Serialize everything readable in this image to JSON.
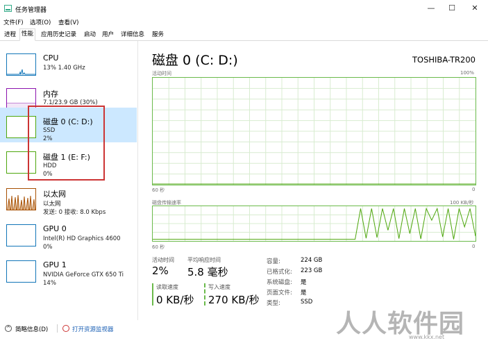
{
  "window": {
    "title": "任务管理器",
    "minimize": "—",
    "maximize": "☐",
    "close": "✕"
  },
  "menu": [
    "文件(F)",
    "选项(O)",
    "查看(V)"
  ],
  "tabs": [
    "进程",
    "性能",
    "应用历史记录",
    "启动",
    "用户",
    "详细信息",
    "服务"
  ],
  "active_tab": "性能",
  "resources": [
    {
      "name": "CPU",
      "line1": "13% 1.40 GHz",
      "line2": ""
    },
    {
      "name": "内存",
      "line1": "7.1/23.9 GB (30%)",
      "line2": ""
    },
    {
      "name": "磁盘 0 (C: D:)",
      "line1": "SSD",
      "line2": "2%"
    },
    {
      "name": "磁盘 1 (E: F:)",
      "line1": "HDD",
      "line2": "0%"
    },
    {
      "name": "以太网",
      "line1": "以太网",
      "line2": "发送: 0 接收: 8.0 Kbps"
    },
    {
      "name": "GPU 0",
      "line1": "Intel(R) HD Graphics 4600",
      "line2": "0%"
    },
    {
      "name": "GPU 1",
      "line1": "NVIDIA GeForce GTX 650 Ti",
      "line2": "14%"
    }
  ],
  "detail": {
    "title": "磁盘 0 (C: D:)",
    "model": "TOSHIBA-TR200",
    "graph1": {
      "label": "活动时间",
      "max": "100%",
      "time": "60 秒",
      "min": "0"
    },
    "graph2": {
      "label": "磁盘传输速率",
      "max": "100 KB/秒",
      "time": "60 秒",
      "min": "0"
    },
    "active_time_label": "活动时间",
    "active_time_value": "2%",
    "avg_response_label": "平均响应时间",
    "avg_response_value": "5.8 毫秒",
    "read_label": "读取速度",
    "read_value": "0 KB/秒",
    "write_label": "写入速度",
    "write_value": "270 KB/秒",
    "properties": [
      {
        "label": "容量:",
        "value": "224 GB"
      },
      {
        "label": "已格式化:",
        "value": "223 GB"
      },
      {
        "label": "系统磁盘:",
        "value": "是"
      },
      {
        "label": "页面文件:",
        "value": "是"
      },
      {
        "label": "类型:",
        "value": "SSD"
      }
    ]
  },
  "footer": {
    "brief": "简略信息(D)",
    "open_monitor": "打开资源监视器"
  },
  "watermark": {
    "text": "人人软件园",
    "url": "www.kkx.net"
  },
  "colors": {
    "cpu": "#1175b8",
    "memory": "#8b12ae",
    "disk": "#4da60c",
    "ethernet": "#a74f01",
    "gpu": "#1175b8",
    "selected": "#cce8ff",
    "highlight": "#cc3333"
  },
  "chart_data": {
    "type": "line",
    "title": "磁盘传输速率",
    "ylim": [
      0,
      100
    ],
    "series": [
      {
        "values": [
          3,
          3,
          3,
          3,
          3,
          3,
          3,
          3,
          3,
          3,
          3,
          3,
          3,
          3,
          3,
          3,
          3,
          3,
          3,
          3,
          3,
          3,
          3,
          3,
          3,
          3,
          3,
          3,
          3,
          3,
          3,
          3,
          3,
          3,
          3,
          3,
          3,
          3,
          95,
          6,
          95,
          8,
          95,
          30,
          95,
          5,
          95,
          20,
          95,
          4,
          95,
          60,
          95,
          10,
          95,
          3,
          95,
          40,
          95,
          12
        ]
      }
    ]
  }
}
